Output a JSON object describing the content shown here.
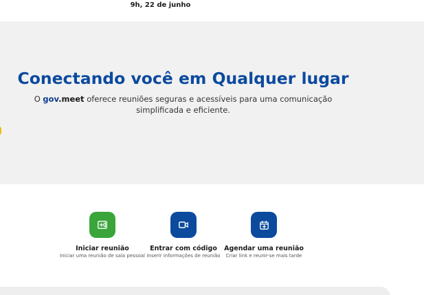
{
  "header": {
    "timestamp": "9h, 22 de junho"
  },
  "hero": {
    "title": "Conectando você em Qualquer lugar",
    "subtitle_prefix": "O ",
    "brand_part1": "gov",
    "brand_part2": ".meet",
    "subtitle_rest": " oferece reuniões seguras e acessíveis para uma comunicação",
    "subtitle_line2": "simplificada e eficiente."
  },
  "actions": [
    {
      "title": "Iniciar reunião",
      "description": "Iniciar uma reunião de sala pessoal",
      "icon": "video-add-icon",
      "color": "#3aa53a"
    },
    {
      "title": "Entrar com código",
      "description": "Inserir informações de reunião",
      "icon": "video-camera-icon",
      "color": "#0c4a9e"
    },
    {
      "title": "Agendar uma reunião",
      "description": "Criar link e reunir-se mais tarde",
      "icon": "calendar-add-icon",
      "color": "#0c4a9e"
    }
  ],
  "colors": {
    "primary": "#0c4a9e",
    "success": "#3aa53a",
    "accent": "#f5b800",
    "hero_background": "#f1f1f1"
  }
}
